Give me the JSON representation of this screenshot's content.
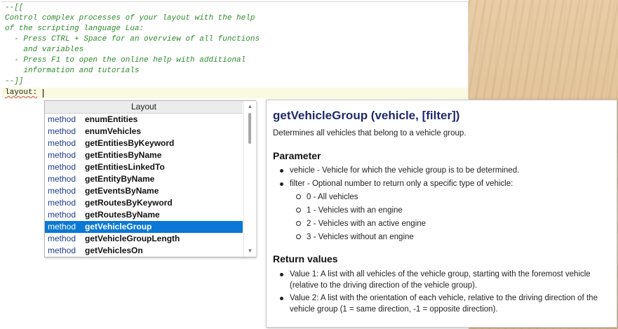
{
  "editor": {
    "comment_lines": [
      "--[[",
      "Control complex processes of your layout with the help",
      "of the scripting language Lua:",
      "  - Press CTRL + Space for an overview of all functions",
      "    and variables",
      "  - Press F1 to open the online help with additional",
      "    information and tutorials",
      "--]]"
    ],
    "current_line": "layout:"
  },
  "autocomplete": {
    "header": "Layout",
    "items": [
      {
        "kind": "method",
        "name": "enumEntities"
      },
      {
        "kind": "method",
        "name": "enumVehicles"
      },
      {
        "kind": "method",
        "name": "getEntitiesByKeyword"
      },
      {
        "kind": "method",
        "name": "getEntitiesByName"
      },
      {
        "kind": "method",
        "name": "getEntitiesLinkedTo"
      },
      {
        "kind": "method",
        "name": "getEntityByName"
      },
      {
        "kind": "method",
        "name": "getEventsByName"
      },
      {
        "kind": "method",
        "name": "getRoutesByKeyword"
      },
      {
        "kind": "method",
        "name": "getRoutesByName"
      },
      {
        "kind": "method",
        "name": "getVehicleGroup",
        "selected": true
      },
      {
        "kind": "method",
        "name": "getVehicleGroupLength"
      },
      {
        "kind": "method",
        "name": "getVehiclesOn"
      }
    ],
    "scroll_up_icon": "triangle-up-icon",
    "scroll_down_icon": "triangle-down-icon"
  },
  "doc": {
    "title": "getVehicleGroup (vehicle, [filter])",
    "description": "Determines all vehicles that belong to a vehicle group.",
    "parameter_heading": "Parameter",
    "parameters": [
      "vehicle - Vehicle for which the vehicle group is to be determined.",
      "filter - Optional number to return only a specific type of vehicle:"
    ],
    "filter_options": [
      "0 - All vehicles",
      "1 - Vehicles with an engine",
      "2 - Vehicles with an active engine",
      "3 - Vehicles without an engine"
    ],
    "return_heading": "Return values",
    "returns": [
      "Value 1: A list with all vehicles of the vehicle group, starting with the foremost vehicle (relative to the driving direction of the vehicle group).",
      "Value 2: A list with the orientation of each vehicle, relative to the driving direction of the vehicle group (1 = same direction, -1 = opposite direction)."
    ]
  }
}
